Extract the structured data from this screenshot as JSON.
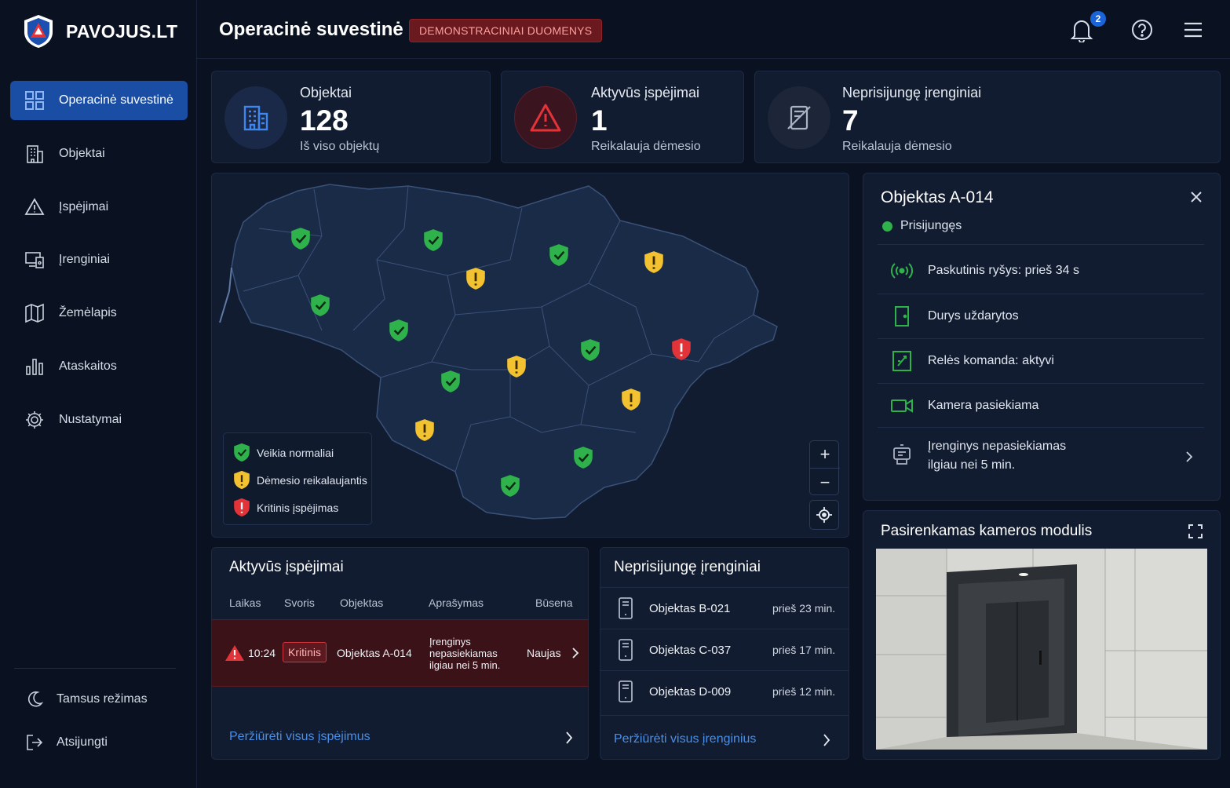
{
  "brand": {
    "name": "PAVOJUS.LT"
  },
  "header": {
    "title": "Operacinė suvestinė",
    "badge": "DEMONSTRACINIAI DUOMENYS",
    "notifications": "2"
  },
  "sidebar": {
    "items": [
      {
        "label": "Operacinė suvestinė",
        "icon": "dashboard-icon"
      },
      {
        "label": "Objektai",
        "icon": "building-icon"
      },
      {
        "label": "Įspėjimai",
        "icon": "warning-icon"
      },
      {
        "label": "Įrenginiai",
        "icon": "devices-icon"
      },
      {
        "label": "Žemėlapis",
        "icon": "map-icon"
      },
      {
        "label": "Ataskaitos",
        "icon": "bar-chart-icon"
      },
      {
        "label": "Nustatymai",
        "icon": "gear-icon"
      }
    ],
    "dark_mode": "Tamsus režimas",
    "logout": "Atsijungti"
  },
  "stats": [
    {
      "label": "Objektai",
      "value": "128",
      "sub": "Iš viso objektų"
    },
    {
      "label": "Aktyvūs įspėjimai",
      "value": "1",
      "sub": "Reikalauja dėmesio"
    },
    {
      "label": "Neprisijungę įrenginiai",
      "value": "7",
      "sub": "Reikalauja dėmesio"
    }
  ],
  "map": {
    "legend": [
      "Veikia normaliai",
      "Dėmesio reikalaujantis",
      "Kritinis įspėjimas"
    ],
    "zoom_in": "+",
    "zoom_out": "−"
  },
  "detail": {
    "title": "Objektas A-014",
    "status": "Prisijungęs",
    "rows": [
      "Paskutinis ryšys: prieš 34 s",
      "Durys uždarytos",
      "Relės komanda: aktyvi",
      "Kamera pasiekiama"
    ],
    "device_line1": "Įrenginys nepasiekiamas",
    "device_line2": "ilgiau nei 5 min."
  },
  "camera": {
    "title": "Pasirenkamas kameros modulis"
  },
  "alerts": {
    "title": "Aktyvūs įspėjimai",
    "headers": [
      "Laikas",
      "Svoris",
      "Objektas",
      "Aprašymas",
      "Būsena"
    ],
    "row": {
      "time": "10:24",
      "severity": "Kritinis",
      "object": "Objektas A-014",
      "desc1": "Įrenginys",
      "desc2": "nepasiekiamas",
      "desc3": "ilgiau nei 5 min.",
      "status": "Naujas"
    },
    "link": "Peržiūrėti visus įspėjimus"
  },
  "offline": {
    "title": "Neprisijungę įrenginiai",
    "rows": [
      {
        "name": "Objektas B-021",
        "time": "prieš 23 min."
      },
      {
        "name": "Objektas C-037",
        "time": "prieš 17 min."
      },
      {
        "name": "Objektas D-009",
        "time": "prieš 12 min."
      }
    ],
    "link": "Peržiūrėti visus įrenginius"
  },
  "colors": {
    "ok": "#2fb24c",
    "warn": "#f2c230",
    "crit": "#e23338",
    "accent": "#1a4ea5"
  }
}
